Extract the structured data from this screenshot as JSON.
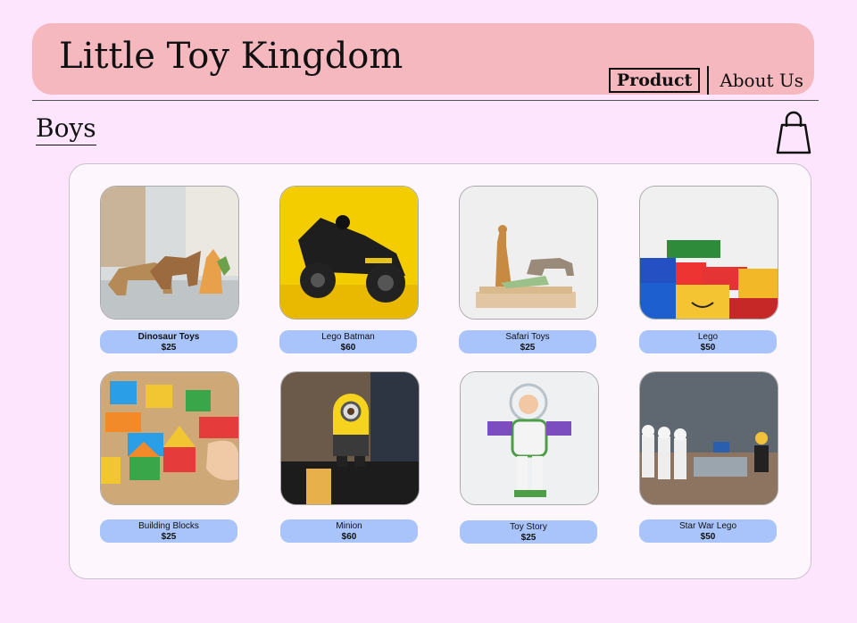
{
  "header": {
    "title": "Little Toy Kingdom",
    "nav": {
      "product": "Product",
      "about": "About Us"
    }
  },
  "section": {
    "title": "Boys"
  },
  "cart": {
    "icon": "shopping-bag-icon"
  },
  "products": [
    {
      "name": "Dinosaur Toys",
      "price": "$25"
    },
    {
      "name": "Lego Batman",
      "price": "$60"
    },
    {
      "name": "Safari Toys",
      "price": "$25"
    },
    {
      "name": "Lego",
      "price": "$50"
    },
    {
      "name": "Building Blocks",
      "price": "$25"
    },
    {
      "name": "Minion",
      "price": "$60"
    },
    {
      "name": "Toy Story",
      "price": "$25"
    },
    {
      "name": "Star War Lego",
      "price": "$50"
    }
  ],
  "colors": {
    "background": "#fde6fd",
    "header": "#f5b8bf",
    "panel": "#fdf7fd",
    "label": "#a9c4fa"
  }
}
